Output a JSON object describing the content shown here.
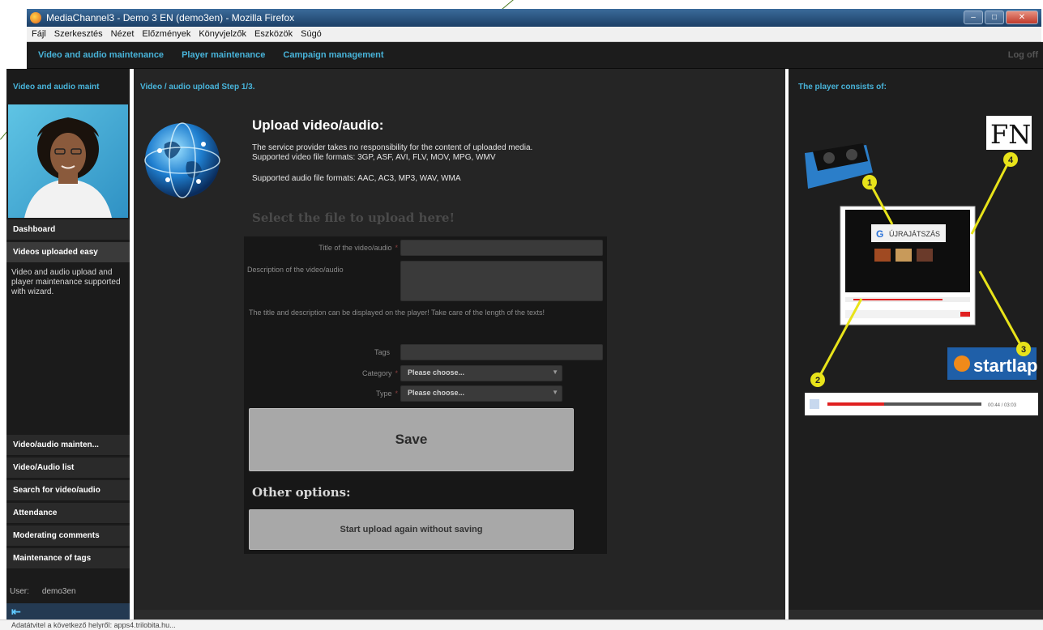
{
  "browser": {
    "window_title": "MediaChannel3 - Demo 3 EN (demo3en) - Mozilla Firefox",
    "menu": [
      "Fájl",
      "Szerkesztés",
      "Nézet",
      "Előzmények",
      "Könyvjelzők",
      "Eszközök",
      "Súgó"
    ],
    "status_text": "Adatátvitel a következő helyről: apps4.trilobita.hu..."
  },
  "nav": {
    "links": [
      "Video and audio maintenance",
      "Player maintenance",
      "Campaign management"
    ],
    "logoff": "Log off"
  },
  "sidebar": {
    "header": "Video and audio maint",
    "dashboard": "Dashboard",
    "active_item": "Videos uploaded easy",
    "description": "Video and audio upload and player maintenance supported with wizard.",
    "items": [
      "Video/audio mainten...",
      "Video/Audio list",
      "Search for video/audio",
      "Attendance",
      "Moderating comments",
      "Maintenance of tags"
    ],
    "user_label": "User:",
    "user_name": "demo3en"
  },
  "main": {
    "header": "Video / audio upload Step 1/3.",
    "upload_title": "Upload video/audio:",
    "disclaimer": "The service provider takes no responsibility for the content of uploaded media.",
    "video_formats": "Supported video file formats: 3GP, ASF, AVI, FLV, MOV, MPG, WMV",
    "audio_formats": "Supported audio file formats: AAC, AC3, MP3, WAV, WMA",
    "select_heading": "Select the file to upload here!",
    "form": {
      "title_label": "Title of the video/audio",
      "title_value": "",
      "description_label": "Description of the video/audio",
      "description_value": "",
      "note": "The title and description can be displayed on the player! Take care of the length of the texts!",
      "tags_label": "Tags",
      "tags_value": "",
      "category_label": "Category",
      "category_value": "Please choose...",
      "type_label": "Type",
      "type_value": "Please choose...",
      "required_mark": "*"
    },
    "save_label": "Save",
    "other_options": "Other options:",
    "restart_label": "Start upload again without saving"
  },
  "right": {
    "header": "The player consists of:",
    "callouts": [
      "1",
      "2",
      "3",
      "4"
    ],
    "fn_logo": "FN",
    "startlap_logo": "startlap",
    "replay_text": "ÚJRAJÁTSZÁS",
    "player_time": "00:44 / 03:03"
  },
  "colors": {
    "accent_blue": "#48b4da",
    "callout_yellow": "#e8e31a",
    "progress_red": "#e02020",
    "panel_dark": "#252525"
  }
}
